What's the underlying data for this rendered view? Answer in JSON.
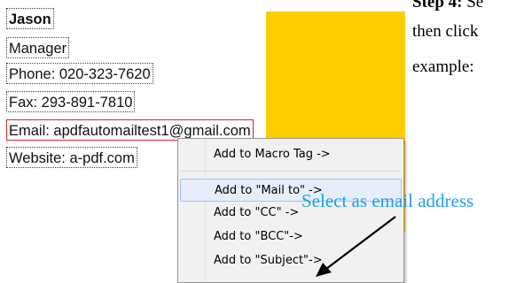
{
  "contact": {
    "name": "Jason",
    "title": "Manager",
    "phone": "Phone: 020-323-7620",
    "fax": "Fax: 293-891-7810",
    "email": "Email: apdfautomailtest1@gmail.com",
    "website": "Website: a-pdf.com"
  },
  "instructions": {
    "line1_bold": "Step 4:",
    "line1_rest": " Se",
    "line2": "then click",
    "line3": "example:"
  },
  "context_menu": {
    "items": [
      {
        "label": "Add to Macro Tag ->"
      },
      {
        "label": "Add to \"Mail to\" ->"
      },
      {
        "label": "Add to \"CC\" ->"
      },
      {
        "label": "Add to \"BCC\"->"
      },
      {
        "label": "Add to \"Subject\"->"
      }
    ],
    "highlighted_index": 1
  },
  "annotation": {
    "text": "Select as email address",
    "color": "#1fa2e6"
  },
  "colors": {
    "highlight_block": "#ffcc00",
    "email_border": "#d42a2a"
  }
}
